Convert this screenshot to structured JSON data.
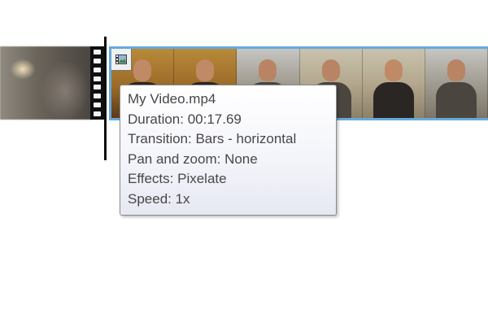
{
  "timeline": {
    "selected_clip": {
      "icon": "film-clip-icon",
      "accent_color": "#67a9d8"
    }
  },
  "tooltip": {
    "filename": "My Video.mp4",
    "duration": "Duration: 00:17.69",
    "transition": "Transition: Bars - horizontal",
    "pan_zoom": "Pan and zoom: None",
    "effects": "Effects: Pixelate",
    "speed": "Speed: 1x"
  }
}
